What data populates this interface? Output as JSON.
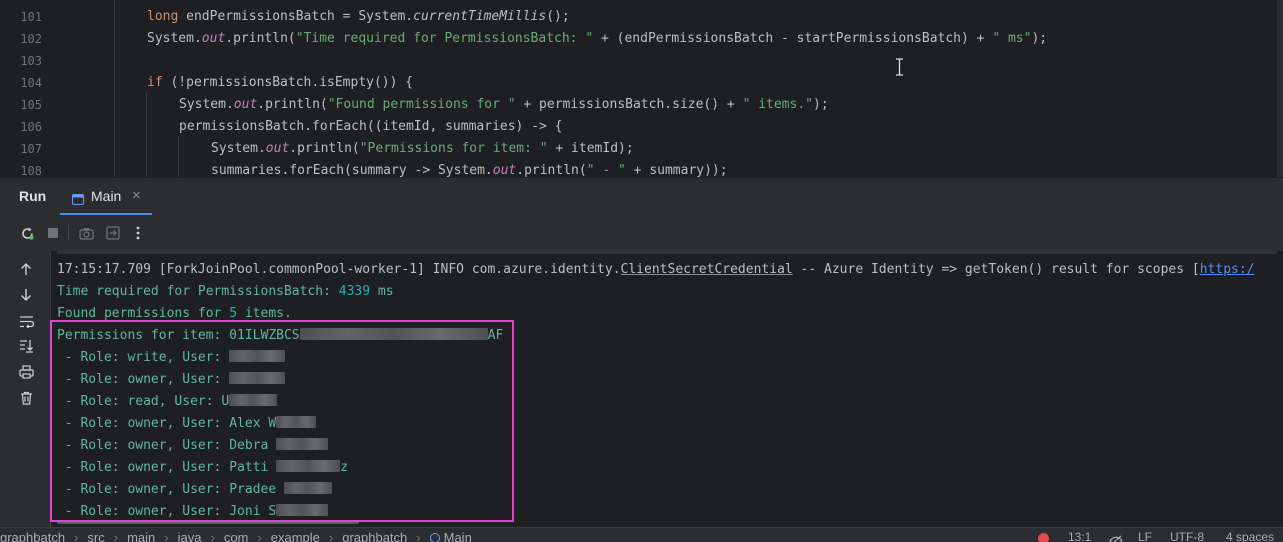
{
  "editor": {
    "lines": [
      {
        "n": "101"
      },
      {
        "n": "102"
      },
      {
        "n": "103"
      },
      {
        "n": "104"
      },
      {
        "n": "105"
      },
      {
        "n": "106"
      },
      {
        "n": "107"
      },
      {
        "n": "108"
      }
    ],
    "code": {
      "l101_kw": "long",
      "l101_rest": " endPermissionsBatch = System.",
      "l101_method": "currentTimeMillis",
      "l101_end": "();",
      "l102_a": "System.",
      "l102_out": "out",
      "l102_b": ".println(",
      "l102_str1": "\"Time required for PermissionsBatch: \"",
      "l102_c": " + (endPermissionsBatch - startPermissionsBatch) + ",
      "l102_str2": "\" ms\"",
      "l102_d": ");",
      "l104_kw": "if",
      "l104_rest": " (!permissionsBatch.isEmpty()) {",
      "l105_a": "System.",
      "l105_out": "out",
      "l105_b": ".println(",
      "l105_str1": "\"Found permissions for \"",
      "l105_c": " + permissionsBatch.size() + ",
      "l105_str2": "\" items.\"",
      "l105_d": ");",
      "l106": "permissionsBatch.forEach((itemId, summaries) -> {",
      "l107_a": "System.",
      "l107_out": "out",
      "l107_b": ".println(",
      "l107_str1": "\"Permissions for item: \"",
      "l107_c": " + itemId);",
      "l108_a": "summaries.forEach(summary -> System.",
      "l108_out": "out",
      "l108_b": ".println(",
      "l108_str1": "\" - \"",
      "l108_c": " + summary));"
    }
  },
  "run_panel": {
    "title": "Run",
    "tab_label": "Main",
    "tab_close": "×"
  },
  "console": {
    "l0": "17:15:17.709 [ForkJoinPool.commonPool-worker-1] INFO com.azure.identity.",
    "l0_class": "ClientSecretCredential",
    "l0_rest": " -- Azure Identity => getToken() result for scopes [",
    "l0_link": "https:/",
    "l1_a": "Time required for PermissionsBatch: ",
    "l1_num": "4339",
    "l1_b": " ms",
    "l2_a": "Found permissions for ",
    "l2_num": "5",
    "l2_b": " items.",
    "l3_a": "Permissions for item: 01ILWZBCS",
    "l3_b": "AF",
    "roles": [
      {
        "prefix": " - Role: ",
        "role": "write",
        "mid": ", User: ",
        "user": ""
      },
      {
        "prefix": " - Role: ",
        "role": "owner",
        "mid": ", User: ",
        "user": ""
      },
      {
        "prefix": " - Role: ",
        "role": "read",
        "mid": ", User: ",
        "user": "U"
      },
      {
        "prefix": " - Role: ",
        "role": "owner",
        "mid": ", User: ",
        "user": "Alex W"
      },
      {
        "prefix": " - Role: ",
        "role": "owner",
        "mid": ", User: ",
        "user": "Debra"
      },
      {
        "prefix": " - Role: ",
        "role": "owner",
        "mid": ", User: ",
        "user": "Patti"
      },
      {
        "prefix": " - Role: ",
        "role": "owner",
        "mid": ", User: ",
        "user": "Pradee"
      },
      {
        "prefix": " - Role: ",
        "role": "owner",
        "mid": ", User: ",
        "user": "Joni S"
      }
    ],
    "patti_tail": "z"
  },
  "statusbar": {
    "breadcrumbs": [
      "graphbatch",
      "src",
      "main",
      "java",
      "com",
      "example",
      "graphbatch",
      "Main"
    ],
    "position": "13:1",
    "line_sep": "LF",
    "encoding": "UTF-8",
    "indent": "4 spaces"
  },
  "colors": {
    "highlight_box": "#e043d6",
    "keyword": "#cf8e6d",
    "string": "#6aab73",
    "number": "#2aacb8"
  }
}
